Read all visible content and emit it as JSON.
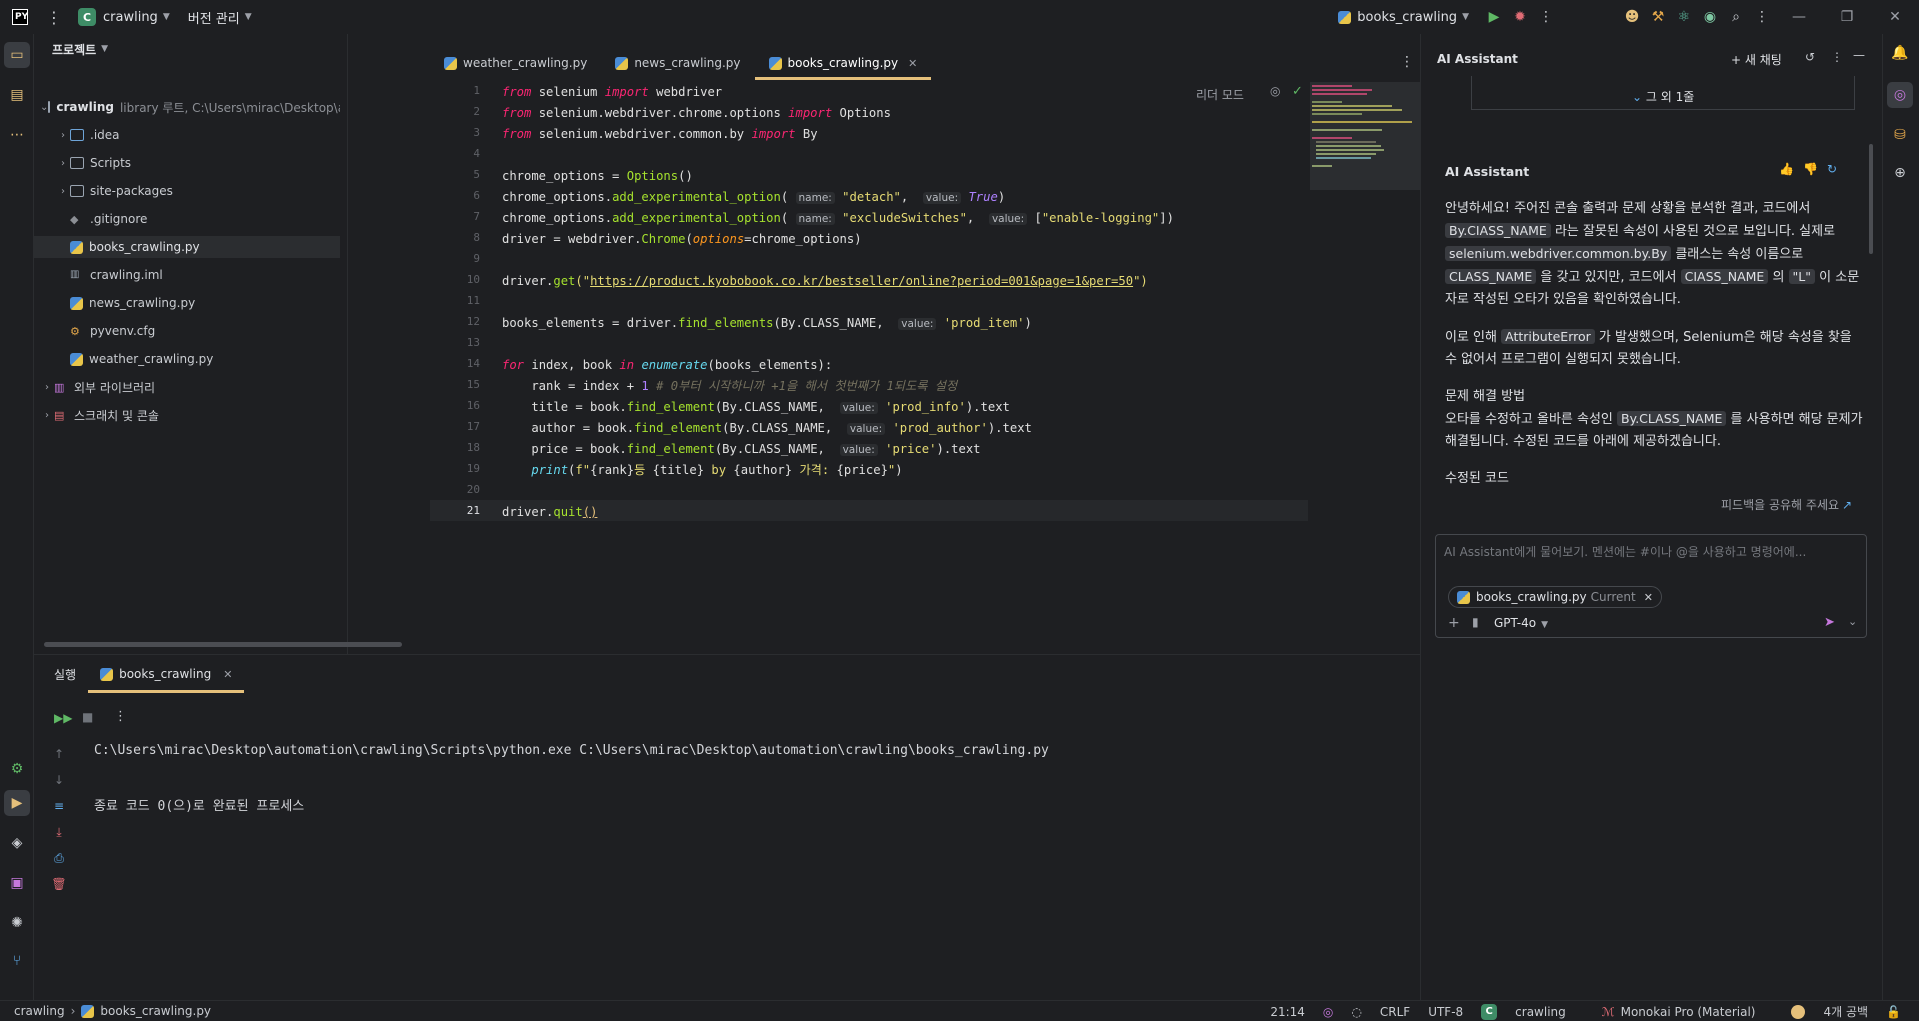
{
  "topbar": {
    "project_name": "crawling",
    "project_initial": "C",
    "vcs_label": "버전 관리",
    "run_config": "books_crawling"
  },
  "project_panel": {
    "title": "프로젝트",
    "root_name": "crawling",
    "root_desc": "library 루트, C:\\Users\\mirac\\Desktop\\automation\\crav",
    "items": [
      {
        "label": ".idea"
      },
      {
        "label": "Scripts"
      },
      {
        "label": "site-packages"
      },
      {
        "label": ".gitignore"
      },
      {
        "label": "books_crawling.py"
      },
      {
        "label": "crawling.iml"
      },
      {
        "label": "news_crawling.py"
      },
      {
        "label": "pyvenv.cfg"
      },
      {
        "label": "weather_crawling.py"
      },
      {
        "label": "외부 라이브러리"
      },
      {
        "label": "스크래치 및 콘솔"
      }
    ]
  },
  "editor": {
    "tabs": [
      {
        "label": "weather_crawling.py"
      },
      {
        "label": "news_crawling.py"
      },
      {
        "label": "books_crawling.py"
      }
    ],
    "reader_mode": "리더 모드",
    "lines": [
      "1",
      "2",
      "3",
      "4",
      "5",
      "6",
      "7",
      "8",
      "9",
      "10",
      "11",
      "12",
      "13",
      "14",
      "15",
      "16",
      "17",
      "18",
      "19",
      "20",
      "21"
    ],
    "code": {
      "l1_a": "from",
      "l1_b": " selenium ",
      "l1_c": "import",
      "l1_d": " webdriver",
      "l2_a": "from",
      "l2_b": " selenium.webdriver.chrome.options ",
      "l2_c": "import",
      "l2_d": " Options",
      "l3_a": "from",
      "l3_b": " selenium.webdriver.common.by ",
      "l3_c": "import",
      "l3_d": " By",
      "l5": "chrome_options = ",
      "l5_fn": "Options",
      "l5_end": "()",
      "l6_a": "chrome_options.",
      "l6_fn": "add_experimental_option",
      "l6_b": "( ",
      "l6_h1": "name:",
      "l6_s1": " \"detach\"",
      "l6_c": ",  ",
      "l6_h2": "value:",
      "l6_v": " True",
      "l6_d": ")",
      "l7_a": "chrome_options.",
      "l7_fn": "add_experimental_option",
      "l7_b": "( ",
      "l7_h1": "name:",
      "l7_s1": " \"excludeSwitches\"",
      "l7_c": ",  ",
      "l7_h2": "value:",
      "l7_d": " [",
      "l7_s2": "\"enable-logging\"",
      "l7_e": "])",
      "l8_a": "driver = webdriver.",
      "l8_fn": "Chrome",
      "l8_b": "(",
      "l8_p": "options",
      "l8_c": "=chrome_options)",
      "l10_a": "driver.",
      "l10_fn": "get",
      "l10_b": "(\"",
      "l10_url": "https://product.kyobobook.co.kr/bestseller/online?period=001&page=1&per=50",
      "l10_c": "\")",
      "l12_a": "books_elements = driver.",
      "l12_fn": "find_elements",
      "l12_b": "(By.CLASS_NAME,  ",
      "l12_h": "value:",
      "l12_s": " 'prod_item'",
      "l12_c": ")",
      "l14_a": "for",
      "l14_b": " index, book ",
      "l14_c": "in",
      "l14_d": " ",
      "l14_e": "enumerate",
      "l14_f": "(books_elements):",
      "l15_a": "    rank = index + ",
      "l15_n": "1",
      "l15_c": " # 0부터 시작하니까 +1을 해서 첫번째가 1되도록 설정",
      "l16_a": "    title = book.",
      "l16_fn": "find_element",
      "l16_b": "(By.CLASS_NAME,  ",
      "l16_h": "value:",
      "l16_s": " 'prod_info'",
      "l16_c": ").text",
      "l17_a": "    author = book.",
      "l17_fn": "find_element",
      "l17_b": "(By.CLASS_NAME,  ",
      "l17_h": "value:",
      "l17_s": " 'prod_author'",
      "l17_c": ").text",
      "l18_a": "    price = book.",
      "l18_fn": "find_element",
      "l18_b": "(By.CLASS_NAME,  ",
      "l18_h": "value:",
      "l18_s": " 'price'",
      "l18_c": ").text",
      "l19_a": "    ",
      "l19_fn": "print",
      "l19_b": "(",
      "l19_s1": "f\"",
      "l19_c": "{rank}",
      "l19_s2": "등 ",
      "l19_d": "{title}",
      "l19_s3": " by ",
      "l19_e": "{author}",
      "l19_s4": " 가격: ",
      "l19_f": "{price}",
      "l19_s5": "\"",
      "l19_g": ")",
      "l21_a": "driver.",
      "l21_fn": "quit",
      "l21_b": "()"
    }
  },
  "run_panel": {
    "tab_run": "실행",
    "tab_config": "books_crawling",
    "command": "C:\\Users\\mirac\\Desktop\\automation\\crawling\\Scripts\\python.exe C:\\Users\\mirac\\Desktop\\automation\\crawling\\books_crawling.py",
    "exit_message": "종료 코드 0(으)로 완료된 프로세스"
  },
  "ai": {
    "title": "AI Assistant",
    "new_chat": "+ 새 채팅",
    "collapsed_more": "그 외 1줄",
    "message_title": "AI Assistant",
    "p1_a": "안녕하세요! 주어진 콘솔 출력과 문제 상황을 분석한 결과, 코드에서 ",
    "p1_code1": "By.CIASS_NAME",
    "p1_b": " 라는 잘못된 속성이 사용된 것으로 보입니다. 실제로 ",
    "p1_code2": "selenium.webdriver.common.by.By",
    "p1_c": " 클래스는 속성 이름으로 ",
    "p1_code3": "CLASS_NAME",
    "p1_d": " 을 갖고 있지만, 코드에서 ",
    "p1_code4": "CIASS_NAME",
    "p1_e": " 의 ",
    "p1_code5": "\"L\"",
    "p1_f": " 이 소문자로 작성된 오타가 있음을 확인하였습니다.",
    "p2_a": "이로 인해 ",
    "p2_code": "AttributeError",
    "p2_b": " 가 발생했으며, Selenium은 해당 속성을 찾을 수 없어서 프로그램이 실행되지 못했습니다.",
    "p3_title": "문제 해결 방법",
    "p3_a": "오타를 수정하고 올바른 속성인 ",
    "p3_code": "By.CLASS_NAME",
    "p3_b": " 를 사용하면 해당 문제가 해결됩니다. 수정된 코드를 아래에 제공하겠습니다.",
    "p4": "수정된 코드",
    "feedback": "피드백을 공유해 주세요",
    "input_placeholder": "AI Assistant에게 물어보기. 멘션에는 #이나 @을 사용하고 명령어에...",
    "chip_file": "books_crawling.py",
    "chip_current": "Current",
    "model": "GPT-4o"
  },
  "status": {
    "breadcrumb_root": "crawling",
    "breadcrumb_file": "books_crawling.py",
    "position": "21:14",
    "line_sep": "CRLF",
    "encoding": "UTF-8",
    "interpreter": "crawling",
    "interpreter_initial": "C",
    "theme": "Monokai Pro (Material)",
    "indent": "4개 공백"
  }
}
